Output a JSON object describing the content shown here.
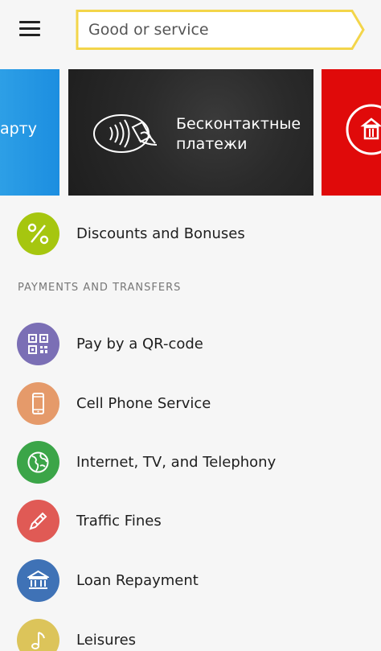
{
  "header": {
    "menu_icon": "hamburger-menu-icon",
    "search_placeholder": "Good or service"
  },
  "banners": [
    {
      "text": "карту",
      "color": "#1c8ee0"
    },
    {
      "line1": "Бесконтактные",
      "line2": "платежи",
      "icon": "contactless-card-icon",
      "color": "#252525"
    },
    {
      "icon": "bank-building-icon",
      "color": "#e00a0a"
    }
  ],
  "discounts": {
    "label": "Discounts and Bonuses",
    "icon": "percent-icon",
    "color": "#a6c60f"
  },
  "section": {
    "title": "PAYMENTS AND TRANSFERS"
  },
  "items": [
    {
      "label": "Pay by a QR-code",
      "icon": "qr-code-icon",
      "color": "#7b6fb5"
    },
    {
      "label": "Cell Phone Service",
      "icon": "mobile-phone-icon",
      "color": "#e59a6a"
    },
    {
      "label": "Internet, TV, and Telephony",
      "icon": "globe-icon",
      "color": "#3ba548"
    },
    {
      "label": "Traffic Fines",
      "icon": "pencil-icon",
      "color": "#e05a55"
    },
    {
      "label": "Loan Repayment",
      "icon": "bank-icon",
      "color": "#3f72b6"
    },
    {
      "label": "Leisures",
      "icon": "music-note-icon",
      "color": "#dcc45a"
    }
  ]
}
